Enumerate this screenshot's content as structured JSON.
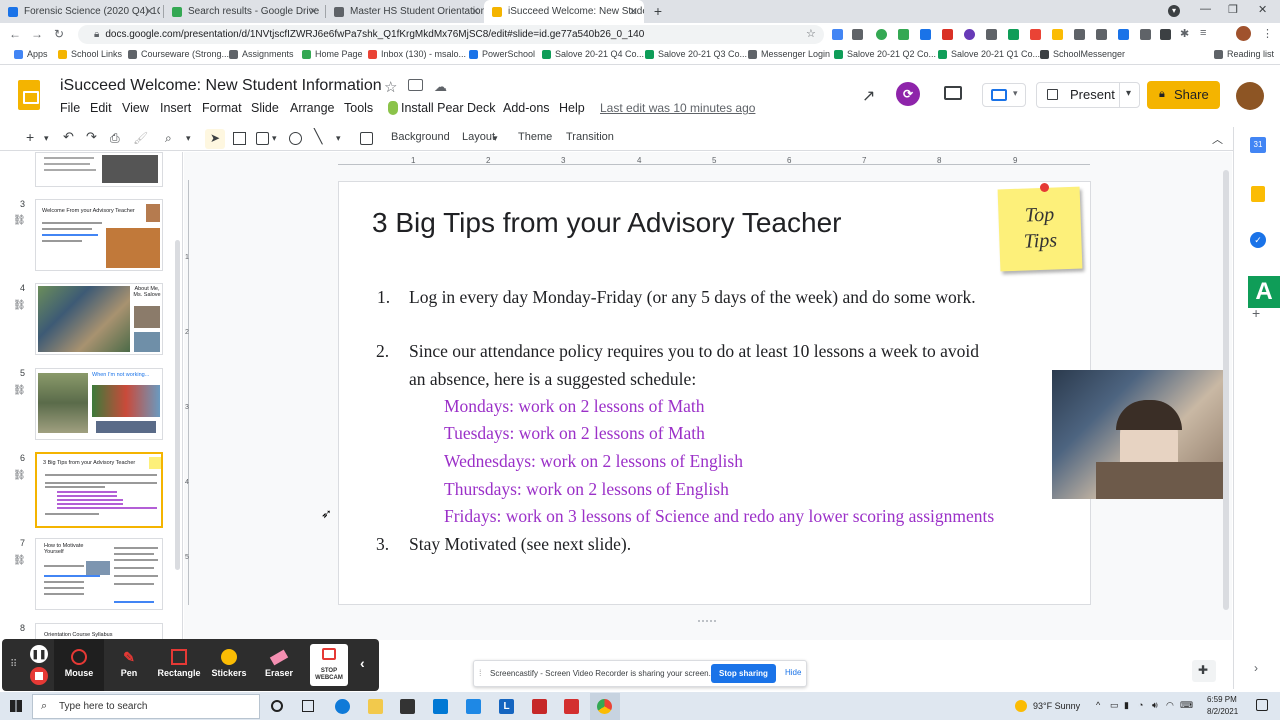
{
  "browser": {
    "tabs": [
      {
        "label": "Forensic Science (2020 Q4) 1Q4",
        "color": "#1a73e8"
      },
      {
        "label": "Search results - Google Drive",
        "color": "#34a853"
      },
      {
        "label": "Master HS Student Orientation",
        "color": "#5f6368"
      },
      {
        "label": "iSucceed Welcome: New Student",
        "color": "#f4b400"
      }
    ],
    "url": "docs.google.com/presentation/d/1NVtjscfIZWRJ6e6fwPa7shk_Q1fKrgMkdMx76MjSC8/edit#slide=id.ge77a540b26_0_140",
    "bookmarks": [
      "Apps",
      "School Links",
      "Courseware (Strong...",
      "Assignments",
      "Home Page",
      "Inbox (130) - msalo...",
      "PowerSchool",
      "Salove 20-21 Q4 Co...",
      "Salove 20-21 Q3 Co...",
      "Messenger Login",
      "Salove 20-21 Q2 Co...",
      "Salove 20-21 Q1 Co...",
      "SchoolMessenger",
      "Reading list"
    ]
  },
  "doc": {
    "title": "iSucceed Welcome: New Student Information",
    "menus": [
      "File",
      "Edit",
      "View",
      "Insert",
      "Format",
      "Slide",
      "Arrange",
      "Tools",
      "Install Pear Deck",
      "Add-ons",
      "Help"
    ],
    "last_edit": "Last edit was 10 minutes ago",
    "present_label": "Present",
    "share_label": "Share"
  },
  "toolbar": {
    "background": "Background",
    "layout": "Layout",
    "theme": "Theme",
    "transition": "Transition"
  },
  "ruler_ticks": [
    "1",
    "2",
    "3",
    "4",
    "5",
    "6",
    "7",
    "8",
    "9"
  ],
  "vruler_ticks": [
    "1",
    "2",
    "3",
    "4",
    "5"
  ],
  "filmstrip": {
    "slides": [
      {
        "num": "3",
        "title": "Welcome From your Advisory Teacher"
      },
      {
        "num": "4",
        "title": "About Me, Ms. Salove"
      },
      {
        "num": "5",
        "title": "When I'm not working..."
      },
      {
        "num": "6",
        "title": "3 Big Tips from your Advisory Teacher"
      },
      {
        "num": "7",
        "title": "How to Motivate Yourself"
      },
      {
        "num": "8",
        "title": "Orientation Course Syllabus"
      }
    ]
  },
  "slide": {
    "title": "3 Big Tips from your Advisory Teacher",
    "sticky": [
      "Top",
      "Tips"
    ],
    "items": [
      {
        "num": "1.",
        "text": "Log in every day Monday-Friday (or any 5 days of the week) and do some work."
      },
      {
        "num": "2.",
        "text": "Since our attendance policy requires you to do at least 10 lessons a week to avoid",
        "text2": "an absence, here is a suggested schedule:"
      },
      {
        "num": "3.",
        "text": "Stay Motivated (see next slide)."
      }
    ],
    "schedule": [
      "Mondays: work on 2 lessons of Math",
      "Tuesdays: work on 2 lessons of Math",
      "Wednesdays: work on 2 lessons of English",
      "Thursdays: work on 2 lessons of English",
      "Fridays: work on 3 lessons of Science and redo any lower scoring assignments"
    ]
  },
  "screencastify": {
    "tools": [
      "Mouse",
      "Pen",
      "Rectangle",
      "Stickers",
      "Eraser",
      "STOP WEBCAM"
    ],
    "share_msg": "Screencastify - Screen Video Recorder is sharing your screen.",
    "stop_sharing": "Stop sharing",
    "hide": "Hide"
  },
  "taskbar": {
    "search_placeholder": "Type here to search",
    "weather": "93°F  Sunny",
    "time": "6:59 PM",
    "date": "8/2/2021"
  },
  "colors": {
    "accent": "#f4b400",
    "purple": "#9b30c8"
  }
}
